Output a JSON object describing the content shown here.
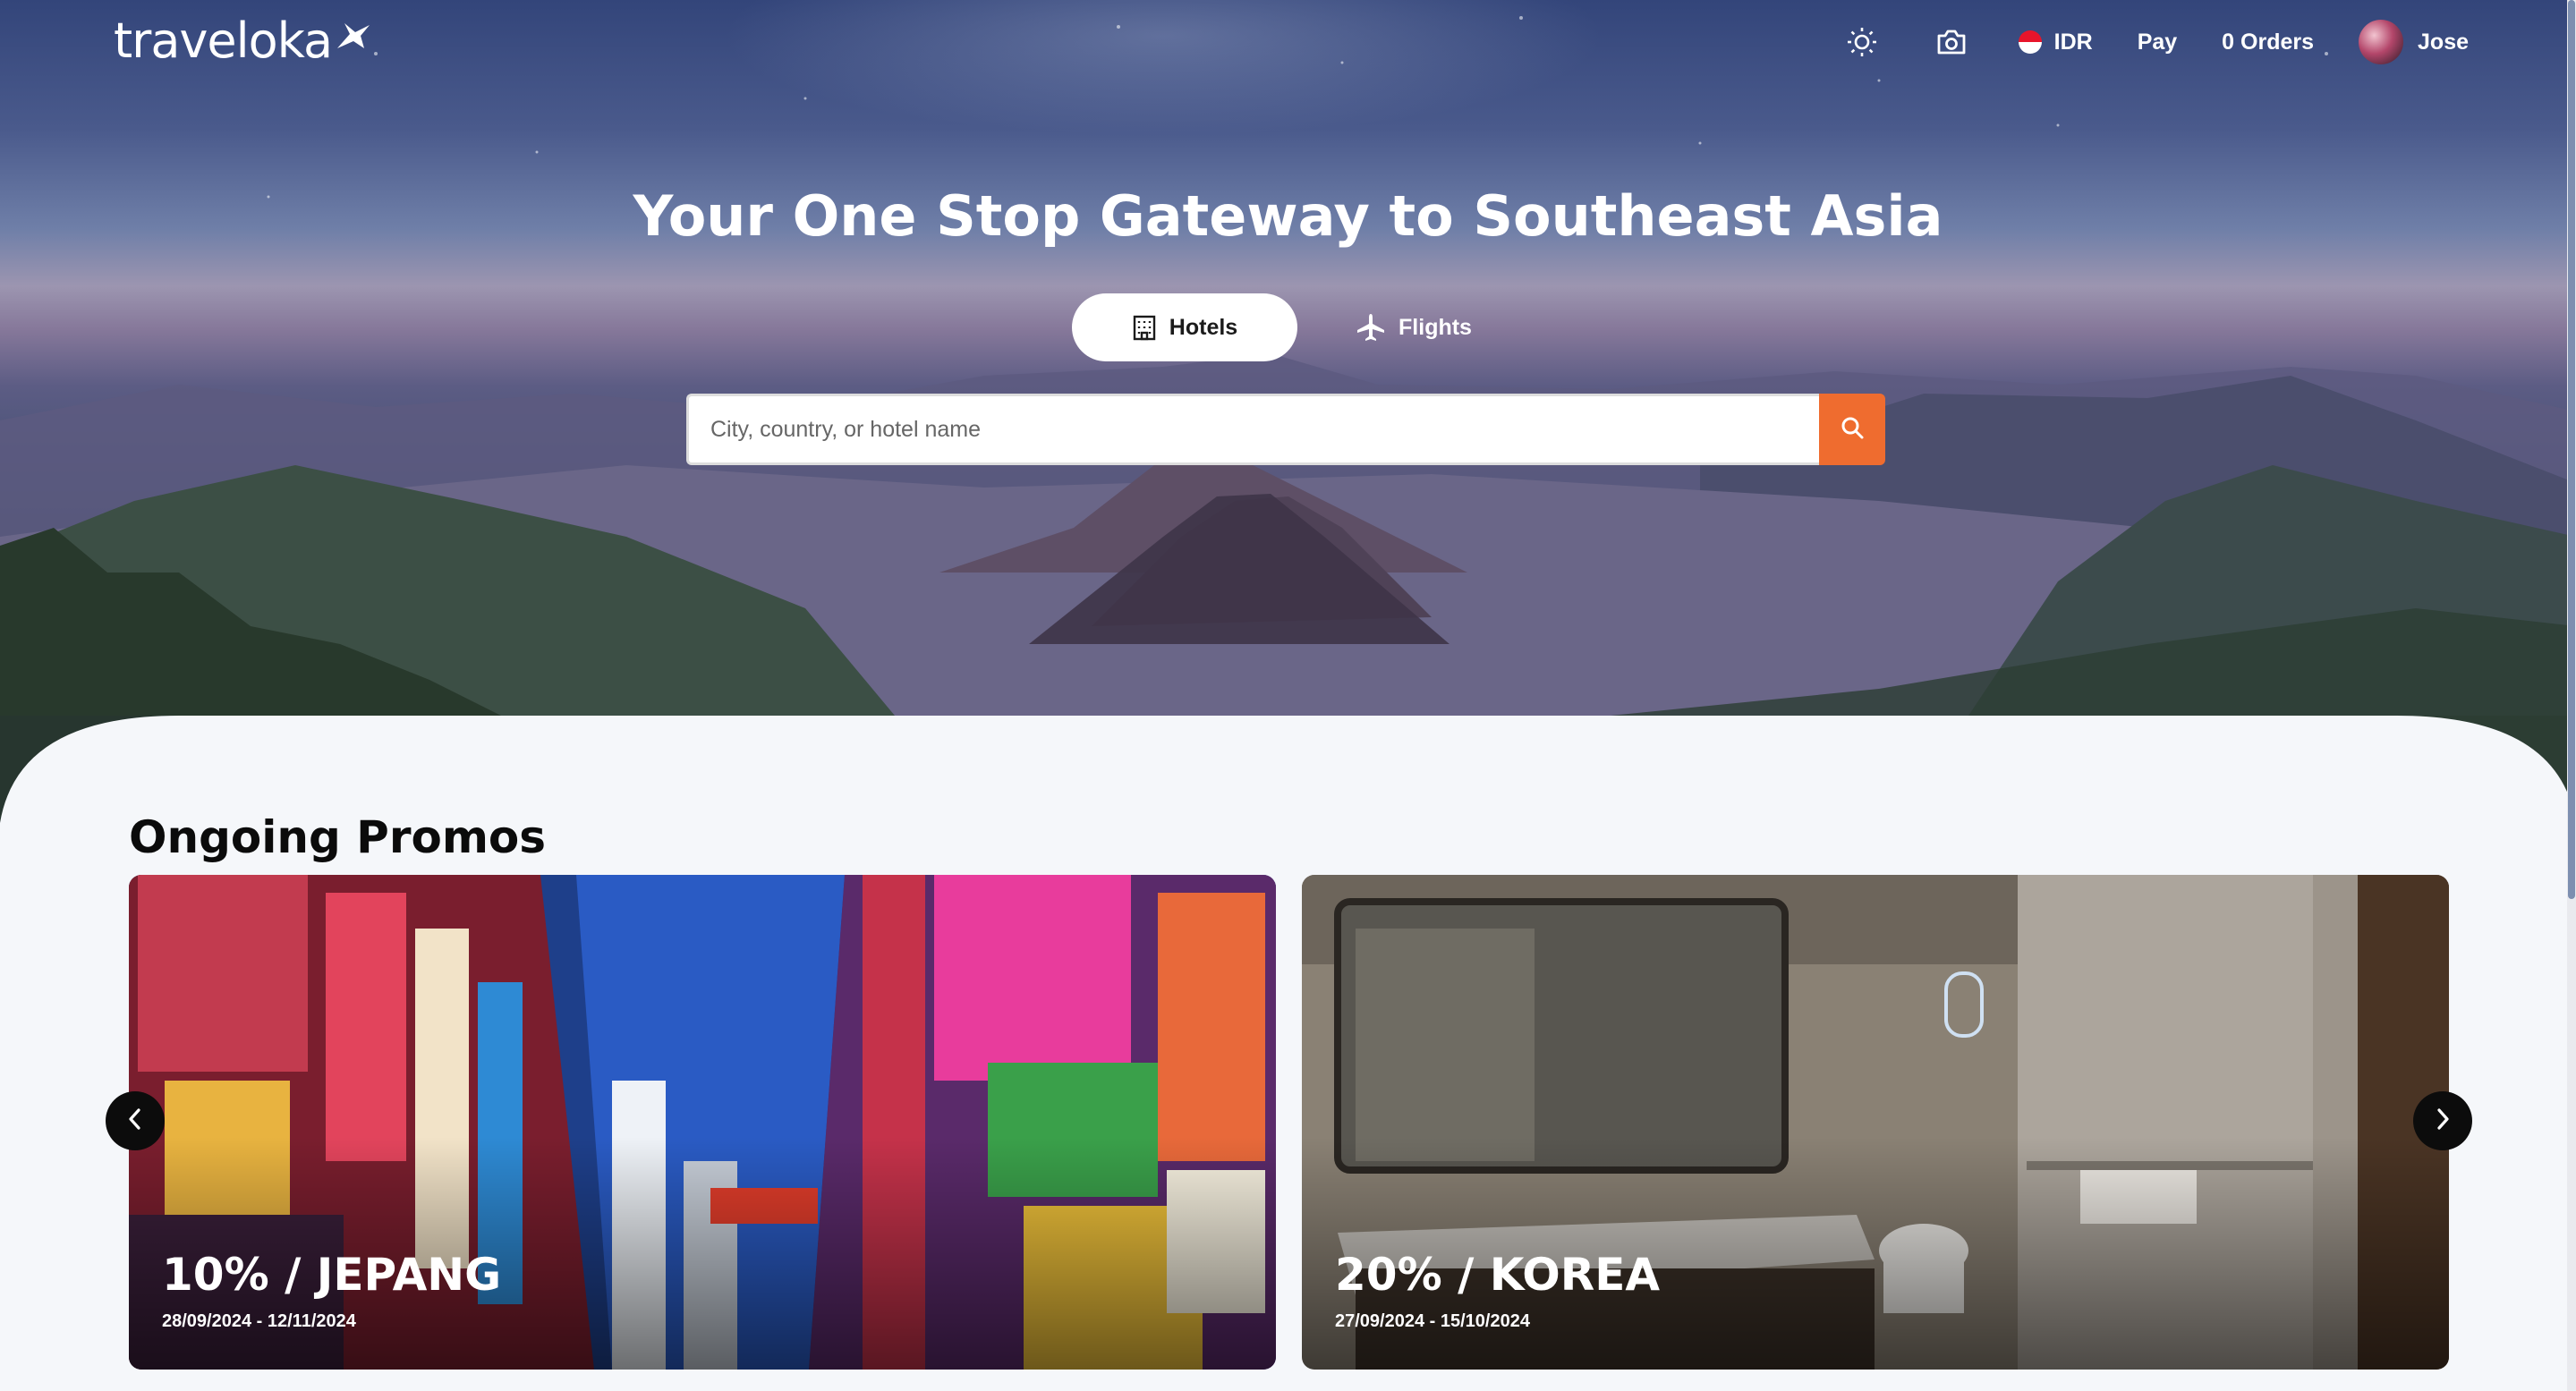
{
  "brand": {
    "logo_text": "traveloka"
  },
  "header": {
    "theme_icon": "sun-icon",
    "camera_icon": "camera-icon",
    "currency": "IDR",
    "pay_label": "Pay",
    "orders_label": "0 Orders",
    "user_name": "Jose"
  },
  "hero": {
    "headline": "Your One Stop Gateway to Southeast Asia",
    "tabs": [
      {
        "label": "Hotels",
        "icon": "building-icon",
        "active": true
      },
      {
        "label": "Flights",
        "icon": "airplane-icon",
        "active": false
      }
    ],
    "search": {
      "placeholder": "City, country, or hotel name",
      "value": ""
    }
  },
  "promos": {
    "title": "Ongoing Promos",
    "items": [
      {
        "title": "10% / JEPANG",
        "dates": "28/09/2024 - 12/11/2024"
      },
      {
        "title": "20% / KOREA",
        "dates": "27/09/2024 - 15/10/2024"
      }
    ]
  },
  "colors": {
    "accent": "#ef6c2f",
    "page_bg": "#f5f7fa",
    "arrow_bg": "#0c0c0c"
  }
}
